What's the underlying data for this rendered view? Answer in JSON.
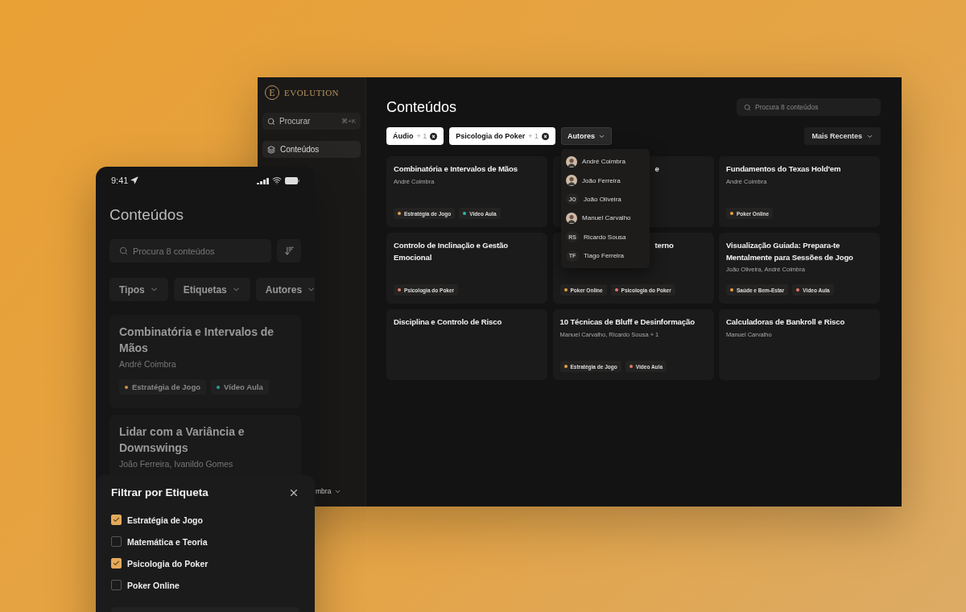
{
  "desktop": {
    "logo": {
      "mark": "E",
      "name": "EVOLUTION"
    },
    "sidebar": {
      "search": {
        "placeholder": "Procurar",
        "shortcut": "⌘+K"
      },
      "items": [
        {
          "label": "Conteúdos",
          "selected": true
        }
      ],
      "user": {
        "name": "mbra"
      }
    },
    "title": "Conteúdos",
    "search": {
      "placeholder": "Procura 8 conteúdos"
    },
    "filters": [
      {
        "label": "Áudio",
        "count": "+ 1",
        "active": true,
        "expanded": false
      },
      {
        "label": "Psicologia do Poker",
        "count": "+ 1",
        "active": true,
        "expanded": false
      },
      {
        "label": "Autores",
        "active": false,
        "expanded": true
      }
    ],
    "authors_menu": [
      {
        "name": "André Coimbra",
        "kind": "photo"
      },
      {
        "name": "João Ferreira",
        "kind": "photo"
      },
      {
        "name": "João Oliveira",
        "kind": "initials",
        "initials": "JO"
      },
      {
        "name": "Manuel Carvalho",
        "kind": "photo"
      },
      {
        "name": "Ricardo Sousa",
        "kind": "initials",
        "initials": "RS"
      },
      {
        "name": "Tiago Ferreira",
        "kind": "initials",
        "initials": "TF"
      }
    ],
    "sort": "Mais Recentes",
    "cards": [
      {
        "title": "Combinatória e Intervalos de Mãos",
        "covered": false,
        "authors": "André Coimbra",
        "tags": [
          {
            "label": "Estratégia de Jogo",
            "color": "#e0a050"
          },
          {
            "label": "Vídeo Aula",
            "color": "#2bb5b0"
          }
        ]
      },
      {
        "title": "e",
        "covered": true
      },
      {
        "title": "Fundamentos do Texas Hold'em",
        "covered": false,
        "authors": "André Coimbra",
        "tags": [
          {
            "label": "Poker Online",
            "color": "#e8a040"
          }
        ]
      },
      {
        "title": "Controlo de Inclinação e Gestão Emocional",
        "covered": false,
        "tags": [
          {
            "label": "Psicologia do Poker",
            "color": "#e07a6a"
          }
        ]
      },
      {
        "title": "terno",
        "covered": true,
        "tags": [
          {
            "label": "Poker Online",
            "color": "#e8a040"
          },
          {
            "label": "Psicologia do Poker",
            "color": "#e07a6a"
          }
        ]
      },
      {
        "title": "Visualização Guiada: Prepara-te Mentalmente para Sessões de Jogo",
        "covered": false,
        "authors": "João Oliveira, André Coimbra",
        "tags": [
          {
            "label": "Saúde e Bem-Estar",
            "color": "#e8a040"
          },
          {
            "label": "Vídeo Aula",
            "color": "#e07a6a"
          }
        ]
      },
      {
        "title": "Disciplina e Controlo de Risco",
        "covered": false
      },
      {
        "title": "10 Técnicas de Bluff e Desinformação",
        "covered": false,
        "authors": "Manuel Carvalho, Ricardo Sousa + 1",
        "tags": [
          {
            "label": "Estratégia de Jogo",
            "color": "#e8a040"
          },
          {
            "label": "Vídeo Aula",
            "color": "#e07a6a"
          }
        ]
      },
      {
        "title": "Calculadoras de Bankroll e Risco",
        "covered": false,
        "authors": "Manuel Carvalho"
      }
    ]
  },
  "mobile": {
    "time": "9:41",
    "title": "Conteúdos",
    "search": {
      "placeholder": "Procura 8 conteúdos"
    },
    "filters": [
      {
        "label": "Tipos"
      },
      {
        "label": "Etiquetas"
      },
      {
        "label": "Autores"
      }
    ],
    "cards": [
      {
        "title": "Combinatória e Intervalos de Mãos",
        "authors": "André Coimbra",
        "tags": [
          {
            "label": "Estratégia de Jogo",
            "color": "#c8914a"
          },
          {
            "label": "Vídeo Aula",
            "color": "#2a9f9a"
          }
        ]
      },
      {
        "title": "Lidar com a Variância e Downswings",
        "authors": "João Ferreira, Ivanildo Gomes"
      }
    ],
    "sheet": {
      "title": "Filtrar por Etiqueta",
      "options": [
        {
          "label": "Estratégia de Jogo",
          "checked": true
        },
        {
          "label": "Matemática e Teoria",
          "checked": false
        },
        {
          "label": "Psicologia do Poker",
          "checked": true
        },
        {
          "label": "Poker Online",
          "checked": false
        }
      ]
    }
  }
}
